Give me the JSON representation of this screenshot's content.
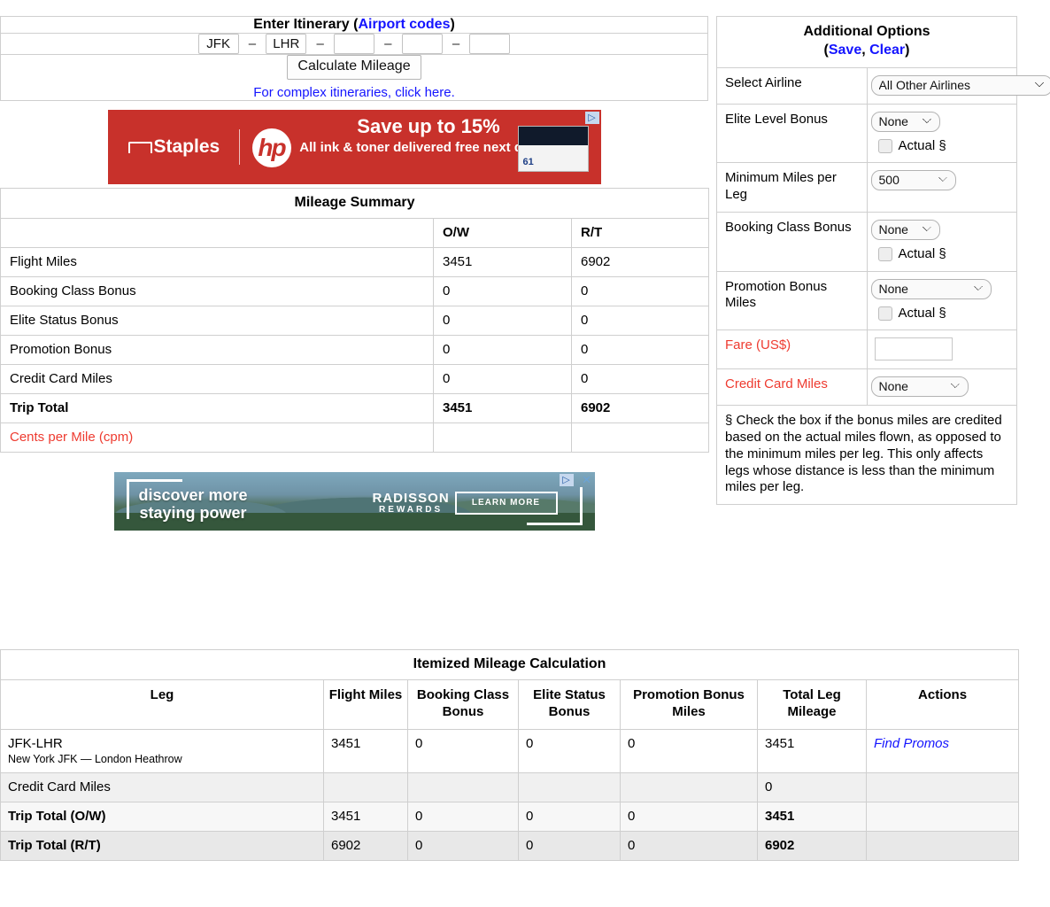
{
  "itinerary": {
    "title_main": "Enter Itinerary",
    "title_paren_open": "(",
    "title_link": "Airport codes",
    "title_paren_close": ")",
    "segments": [
      {
        "value": "JFK",
        "placeholder": ""
      },
      {
        "value": "LHR",
        "placeholder": ""
      },
      {
        "value": "",
        "placeholder": ""
      },
      {
        "value": "",
        "placeholder": ""
      },
      {
        "value": "",
        "placeholder": ""
      }
    ],
    "separator": "–",
    "calculate_label": "Calculate Mileage",
    "complex_link": "For complex itineraries, click here."
  },
  "ads": {
    "staples": {
      "brand": "Staples",
      "hp": "hp",
      "headline": "Save up to 15%",
      "subline": "All ink & toner delivered free next day. *",
      "product_number": "61",
      "adchoices": "▷"
    },
    "radisson": {
      "tagline_line1": "discover more",
      "tagline_line2": "staying power",
      "brand": "RADISSON",
      "brand_sub": "REWARDS",
      "cta": "LEARN MORE",
      "adchoices": "▷",
      "close": "×"
    }
  },
  "summary": {
    "title": "Mileage Summary",
    "columns": [
      "",
      "O/W",
      "R/T"
    ],
    "rows": [
      {
        "label": "Flight Miles",
        "ow": "3451",
        "rt": "6902",
        "bold": false,
        "red": false
      },
      {
        "label": "Booking Class Bonus",
        "ow": "0",
        "rt": "0",
        "bold": false,
        "red": false
      },
      {
        "label": "Elite Status Bonus",
        "ow": "0",
        "rt": "0",
        "bold": false,
        "red": false
      },
      {
        "label": "Promotion Bonus",
        "ow": "0",
        "rt": "0",
        "bold": false,
        "red": false
      },
      {
        "label": "Credit Card Miles",
        "ow": "0",
        "rt": "0",
        "bold": false,
        "red": false
      },
      {
        "label": "Trip Total",
        "ow": "3451",
        "rt": "6902",
        "bold": true,
        "red": false
      },
      {
        "label": "Cents per Mile (cpm)",
        "ow": "",
        "rt": "",
        "bold": false,
        "red": true
      }
    ]
  },
  "options": {
    "title": "Additional Options",
    "paren_open": "(",
    "save_link": "Save",
    "comma": ", ",
    "clear_link": "Clear",
    "paren_close": ")",
    "select_airline": {
      "label": "Select Airline",
      "value": "All Other Airlines"
    },
    "elite_level": {
      "label": "Elite Level Bonus",
      "value": "None",
      "checkbox_label": "Actual §",
      "checked": false
    },
    "minimum_miles": {
      "label": "Minimum Miles per Leg",
      "value": "500"
    },
    "booking_class": {
      "label": "Booking Class Bonus",
      "value": "None",
      "checkbox_label": "Actual §",
      "checked": false
    },
    "promotion_bonus": {
      "label": "Promotion Bonus Miles",
      "value": "None",
      "checkbox_label": "Actual §",
      "checked": false
    },
    "fare": {
      "label": "Fare (US$)",
      "value": "",
      "placeholder": ""
    },
    "credit_card": {
      "label": "Credit Card Miles",
      "value": "None"
    },
    "footnote": "§ Check the box if the bonus miles are credited based on the actual miles flown, as opposed to the minimum miles per leg. This only affects legs whose distance is less than the minimum miles per leg."
  },
  "itemized": {
    "title": "Itemized Mileage Calculation",
    "columns": [
      "Leg",
      "Flight Miles",
      "Booking Class Bonus",
      "Elite Status Bonus",
      "Promotion Bonus Miles",
      "Total Leg Mileage",
      "Actions"
    ],
    "rows": [
      {
        "kind": "leg",
        "leg_code": "JFK-LHR",
        "leg_sub": "New York JFK — London Heathrow",
        "flight_miles": "3451",
        "booking_class_bonus": "0",
        "elite_status_bonus": "0",
        "promotion_bonus_miles": "0",
        "total_leg_mileage": "3451",
        "action": "Find Promos"
      },
      {
        "kind": "credit",
        "leg_code": "Credit Card Miles",
        "leg_sub": "",
        "flight_miles": "",
        "booking_class_bonus": "",
        "elite_status_bonus": "",
        "promotion_bonus_miles": "",
        "total_leg_mileage": "0",
        "action": ""
      },
      {
        "kind": "total-ow",
        "leg_code": "Trip Total (O/W)",
        "leg_sub": "",
        "flight_miles": "3451",
        "booking_class_bonus": "0",
        "elite_status_bonus": "0",
        "promotion_bonus_miles": "0",
        "total_leg_mileage": "3451",
        "action": ""
      },
      {
        "kind": "total-rt",
        "leg_code": "Trip Total (R/T)",
        "leg_sub": "",
        "flight_miles": "6902",
        "booking_class_bonus": "0",
        "elite_status_bonus": "0",
        "promotion_bonus_miles": "0",
        "total_leg_mileage": "6902",
        "action": ""
      }
    ]
  },
  "colors": {
    "link": "#1414ff",
    "red": "#ee3b30",
    "border": "#cfcfcf",
    "ad_staples_bg": "#c8312b"
  }
}
